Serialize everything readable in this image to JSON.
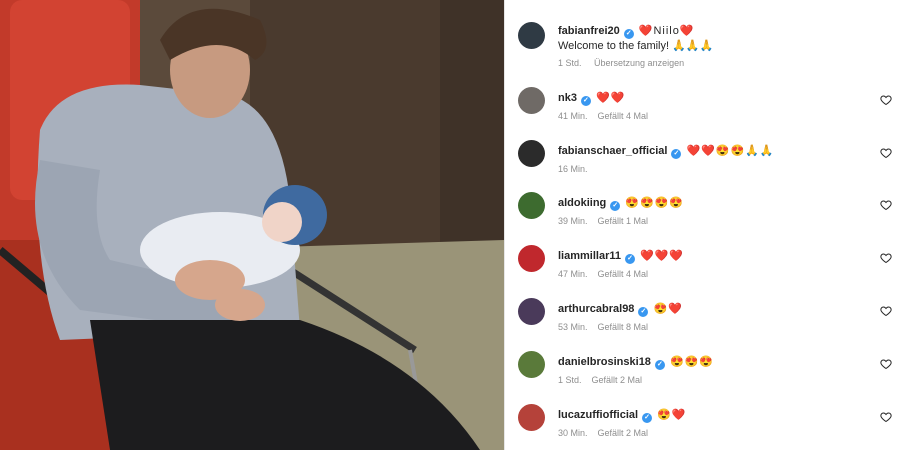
{
  "post": {
    "username": "fabianfrei20",
    "caption_line1": "❤️Niilo❤️",
    "caption_line2": "Welcome to the family! 🙏🙏🙏",
    "time": "1 Std.",
    "translate": "Übersetzung anzeigen"
  },
  "comments": [
    {
      "username": "nk3",
      "text": "❤️❤️",
      "time": "41 Min.",
      "likes": "Gefällt 4 Mal",
      "avatar_color": "#6f6a66"
    },
    {
      "username": "fabianschaer_official",
      "text": "❤️❤️😍😍🙏🙏",
      "time": "16 Min.",
      "likes": "",
      "avatar_color": "#2b2b2b"
    },
    {
      "username": "aldokiing",
      "text": "😍😍😍😍",
      "time": "39 Min.",
      "likes": "Gefällt 1 Mal",
      "avatar_color": "#3d6b2f"
    },
    {
      "username": "liammillar11",
      "text": "❤️❤️❤️",
      "time": "47 Min.",
      "likes": "Gefällt 4 Mal",
      "avatar_color": "#c0282d"
    },
    {
      "username": "arthurcabral98",
      "text": "😍❤️",
      "time": "53 Min.",
      "likes": "Gefällt 8 Mal",
      "avatar_color": "#4a3a5a"
    },
    {
      "username": "danielbrosinski18",
      "text": "😍😍😍",
      "time": "1 Std.",
      "likes": "Gefällt 2 Mal",
      "avatar_color": "#5a7a3a"
    },
    {
      "username": "lucazuffiofficial",
      "text": "😍❤️",
      "time": "30 Min.",
      "likes": "Gefällt 2 Mal",
      "avatar_color": "#b5423a"
    }
  ],
  "icons": {
    "like": "heart-outline-icon",
    "verified": "verified-badge-icon"
  },
  "colors": {
    "verified": "#3897f0",
    "meta": "#8e8e8e",
    "text": "#262626"
  }
}
